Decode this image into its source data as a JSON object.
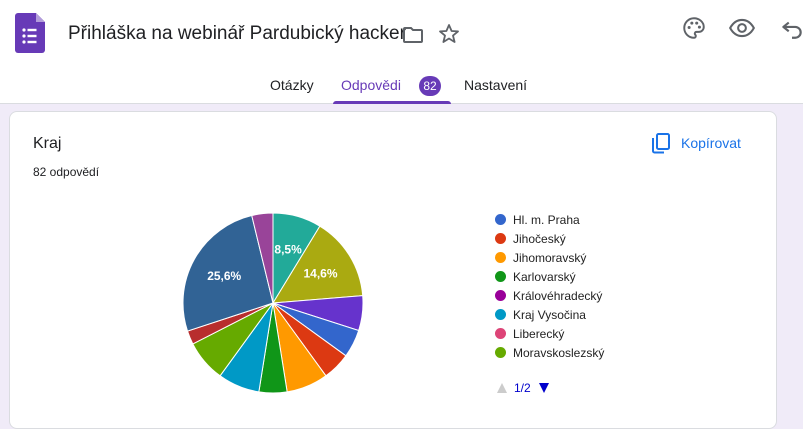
{
  "header": {
    "title": "Přihláška na webinář Pardubický hacker",
    "icons": [
      "forms-app-icon",
      "folder-icon",
      "star-icon",
      "palette-icon",
      "preview-eye-icon",
      "undo-icon"
    ],
    "accent": "#673ab7"
  },
  "tabs": {
    "questions": "Otázky",
    "responses": "Odpovědi",
    "responses_count": "82",
    "settings": "Nastavení"
  },
  "question": {
    "title": "Kraj",
    "response_count": "82 odpovědí",
    "copy_label": "Kopírovat"
  },
  "chart_data": {
    "type": "pie",
    "title": "Kraj",
    "slices": [
      {
        "label": "",
        "value": 8.5,
        "shown": "8,5%",
        "color": "#22aa99"
      },
      {
        "label": "",
        "value": 14.6,
        "shown": "14,6%",
        "color": "#aaaa11"
      },
      {
        "label": "",
        "value": 6.1,
        "shown": "",
        "color": "#6633cc"
      },
      {
        "label": "Hl. m. Praha",
        "value": 4.9,
        "shown": "",
        "color": "#3366cc"
      },
      {
        "label": "Jihočeský",
        "value": 4.9,
        "shown": "",
        "color": "#dc3912"
      },
      {
        "label": "Jihomoravský",
        "value": 7.3,
        "shown": "",
        "color": "#ff9900"
      },
      {
        "label": "Karlovarský",
        "value": 4.9,
        "shown": "",
        "color": "#109618"
      },
      {
        "label": "Kraj Vysočina",
        "value": 7.3,
        "shown": "",
        "color": "#0099c6"
      },
      {
        "label": "Moravskoslezský",
        "value": 7.3,
        "shown": "",
        "color": "#66aa00"
      },
      {
        "label": "",
        "value": 2.4,
        "shown": "",
        "color": "#b82e2e"
      },
      {
        "label": "",
        "value": 25.6,
        "shown": "25,6%",
        "color": "#316395"
      },
      {
        "label": "",
        "value": 3.7,
        "shown": "",
        "color": "#994499"
      }
    ],
    "legend": [
      {
        "label": "Hl. m. Praha",
        "color": "#3366cc"
      },
      {
        "label": "Jihočeský",
        "color": "#dc3912"
      },
      {
        "label": "Jihomoravský",
        "color": "#ff9900"
      },
      {
        "label": "Karlovarský",
        "color": "#109618"
      },
      {
        "label": "Královéhradecký",
        "color": "#990099"
      },
      {
        "label": "Kraj Vysočina",
        "color": "#0099c6"
      },
      {
        "label": "Liberecký",
        "color": "#dd4477"
      },
      {
        "label": "Moravskoslezský",
        "color": "#66aa00"
      }
    ],
    "legend_placement": "right",
    "legend_page": "1/2"
  }
}
